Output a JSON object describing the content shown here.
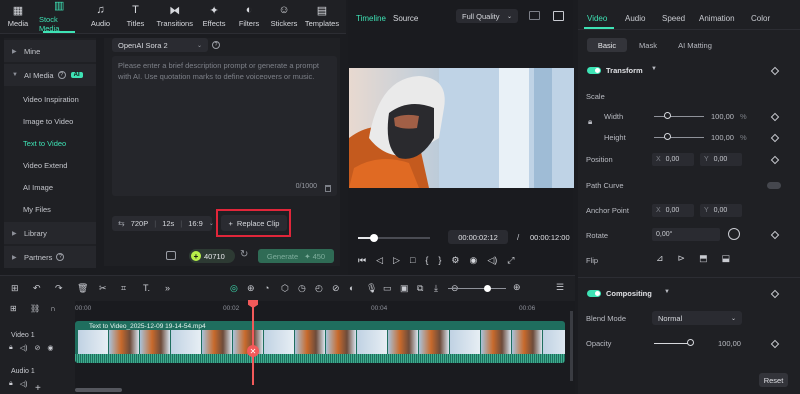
{
  "toolbar": {
    "items": [
      {
        "label": "Media",
        "icon": "media-icon"
      },
      {
        "label": "Stock Media",
        "icon": "stock-media-icon",
        "active": true
      },
      {
        "label": "Audio",
        "icon": "audio-icon"
      },
      {
        "label": "Titles",
        "icon": "titles-icon"
      },
      {
        "label": "Transitions",
        "icon": "transitions-icon"
      },
      {
        "label": "Effects",
        "icon": "effects-icon"
      },
      {
        "label": "Filters",
        "icon": "filters-icon"
      },
      {
        "label": "Stickers",
        "icon": "stickers-icon"
      },
      {
        "label": "Templates",
        "icon": "templates-icon"
      }
    ]
  },
  "leftnav": {
    "mine": "Mine",
    "ai_media": "AI Media",
    "ai_badge": "AI",
    "sub": [
      "Video Inspiration",
      "Image to Video",
      "Text to Video",
      "Video Extend",
      "AI Image",
      "My Files"
    ],
    "library": "Library",
    "partners": "Partners"
  },
  "ttv": {
    "model": "OpenAI Sora 2",
    "prompt_placeholder": "Please enter a brief description prompt or generate a prompt with AI. Use quotation marks to define voiceovers or music.",
    "char_count": "0/1000",
    "resolution": "720P",
    "duration": "12s",
    "ratio": "16:9",
    "replace_clip": "Replace Clip",
    "credits": "40710",
    "generate": "Generate",
    "generate_cost": "450"
  },
  "preview": {
    "tab_timeline": "Timeline",
    "tab_source": "Source",
    "quality": "Full Quality",
    "current_time": "00:00:02:12",
    "separator": "/",
    "total_time": "00:00:12:00"
  },
  "right": {
    "tabs": [
      "Video",
      "Audio",
      "Speed",
      "Animation",
      "Color"
    ],
    "subtabs": [
      "Basic",
      "Mask",
      "AI Matting"
    ],
    "transform": "Transform",
    "scale": "Scale",
    "width": "Width",
    "width_val": "100,00",
    "height": "Height",
    "height_val": "100,00",
    "pct": "%",
    "position": "Position",
    "pos_x_label": "X",
    "pos_x": "0,00",
    "pos_y_label": "Y",
    "pos_y": "0,00",
    "path_curve": "Path Curve",
    "anchor_point": "Anchor Point",
    "anc_x": "0,00",
    "anc_y": "0,00",
    "rotate": "Rotate",
    "rotate_val": "0,00°",
    "flip": "Flip",
    "compositing": "Compositing",
    "blend_mode": "Blend Mode",
    "blend_val": "Normal",
    "opacity": "Opacity",
    "opacity_val": "100,00",
    "reset": "Reset"
  },
  "timeline": {
    "ticks": [
      "00:00",
      "00:02",
      "00:04",
      "00:06"
    ],
    "video_track": "Video 1",
    "audio_track": "Audio 1",
    "clip_name": "Text to Video_2025-12-09 19-14-54.mp4"
  },
  "colors": {
    "accent": "#3ee3b5",
    "highlight": "#e0263a",
    "playhead": "#f25a5a"
  }
}
